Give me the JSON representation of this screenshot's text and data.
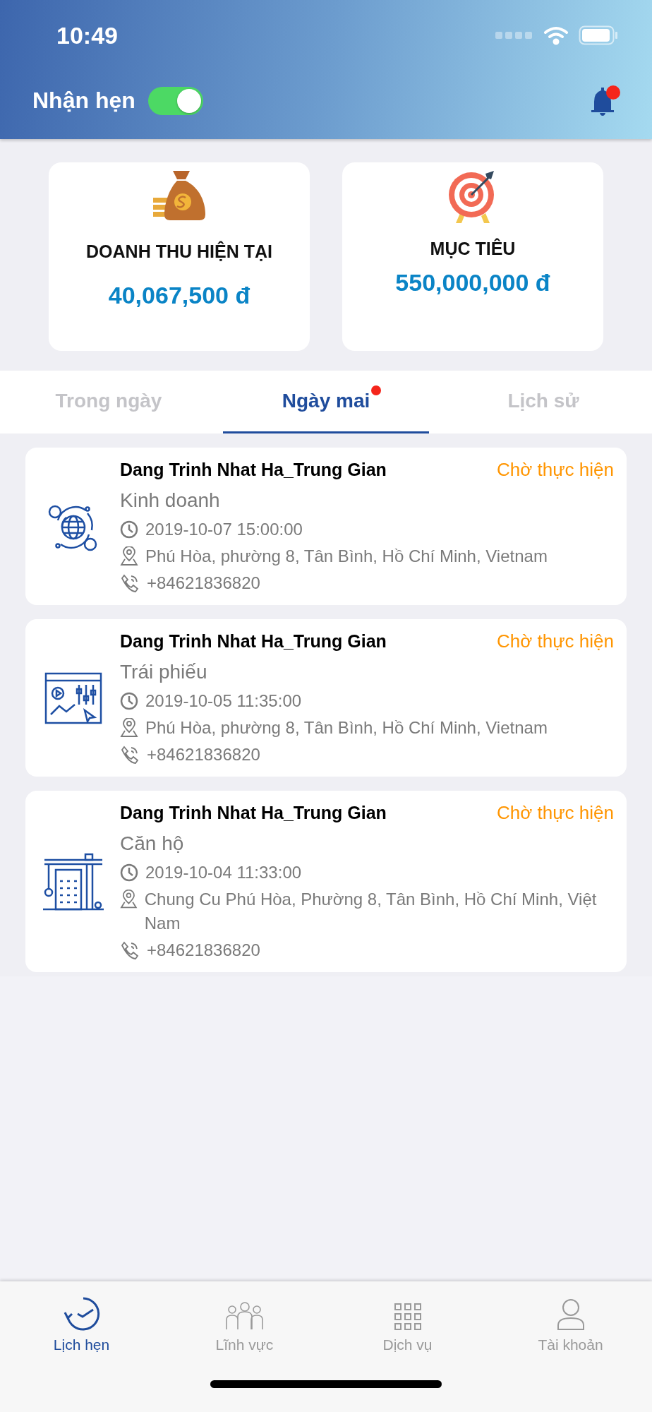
{
  "status_bar": {
    "time": "10:49"
  },
  "header": {
    "label": "Nhận hẹn",
    "toggle_on": true,
    "unread_notifications": true
  },
  "stats": [
    {
      "kind": "revenue",
      "label": "DOANH THU HIỆN TẠI",
      "value": "40,067,500 đ"
    },
    {
      "kind": "target",
      "label": "MỤC TIÊU",
      "value": "550,000,000 đ"
    }
  ],
  "tabs": [
    {
      "label": "Trong ngày",
      "selected": false,
      "badge": false
    },
    {
      "label": "Ngày mai",
      "selected": true,
      "badge": true
    },
    {
      "label": "Lịch sử",
      "selected": false,
      "badge": false
    }
  ],
  "appointments": [
    {
      "kind": "finance",
      "name": "Dang Trinh Nhat Ha_Trung Gian",
      "status": "Chờ thực hiện",
      "category": "Kinh doanh",
      "time": "2019-10-07 15:00:00",
      "address": "Phú Hòa, phường 8, Tân Bình, Hồ Chí Minh, Vietnam",
      "phone": "+84621836820"
    },
    {
      "kind": "chart",
      "name": "Dang Trinh Nhat Ha_Trung Gian",
      "status": "Chờ thực hiện",
      "category": "Trái phiếu",
      "time": "2019-10-05 11:35:00",
      "address": "Phú Hòa, phường 8, Tân Bình, Hồ Chí Minh, Vietnam",
      "phone": "+84621836820"
    },
    {
      "kind": "construction",
      "name": "Dang Trinh Nhat Ha_Trung Gian",
      "status": "Chờ thực hiện",
      "category": "Căn hộ",
      "time": "2019-10-04 11:33:00",
      "address": "Chung Cu Phú Hòa, Phường 8, Tân Bình, Hồ Chí Minh, Việt Nam",
      "phone": "+84621836820"
    }
  ],
  "bottom_nav": [
    {
      "kind": "schedule",
      "label": "Lịch hẹn",
      "selected": true
    },
    {
      "kind": "people",
      "label": "Lĩnh vực",
      "selected": false
    },
    {
      "kind": "grid",
      "label": "Dịch vụ",
      "selected": false
    },
    {
      "kind": "account",
      "label": "Tài khoản",
      "selected": false
    }
  ]
}
